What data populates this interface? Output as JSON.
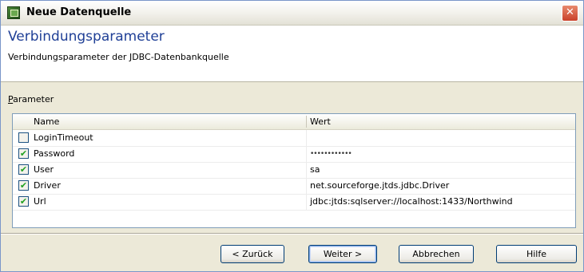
{
  "window": {
    "title": "Neue Datenquelle",
    "close_label": "✕"
  },
  "header": {
    "title": "Verbindungsparameter",
    "description": "Verbindungsparameter der JDBC-Datenbankquelle"
  },
  "parameters": {
    "label_mnemonic": "P",
    "label_rest": "arameter",
    "columns": {
      "name": "Name",
      "value": "Wert"
    },
    "rows": [
      {
        "checked": false,
        "name": "LoginTimeout",
        "value": ""
      },
      {
        "checked": true,
        "name": "Password",
        "value": "••••••••••••"
      },
      {
        "checked": true,
        "name": "User",
        "value": "sa"
      },
      {
        "checked": true,
        "name": "Driver",
        "value": "net.sourceforge.jtds.jdbc.Driver"
      },
      {
        "checked": true,
        "name": "Url",
        "value": "jdbc:jtds:sqlserver://localhost:1433/Northwind"
      }
    ]
  },
  "buttons": {
    "back": "< Zurück",
    "next": "Weiter >",
    "cancel": "Abbrechen",
    "help": "Hilfe"
  },
  "colors": {
    "header_title": "#1f3f96",
    "close_button": "#c9412a",
    "checkbox_check": "#21a121"
  }
}
